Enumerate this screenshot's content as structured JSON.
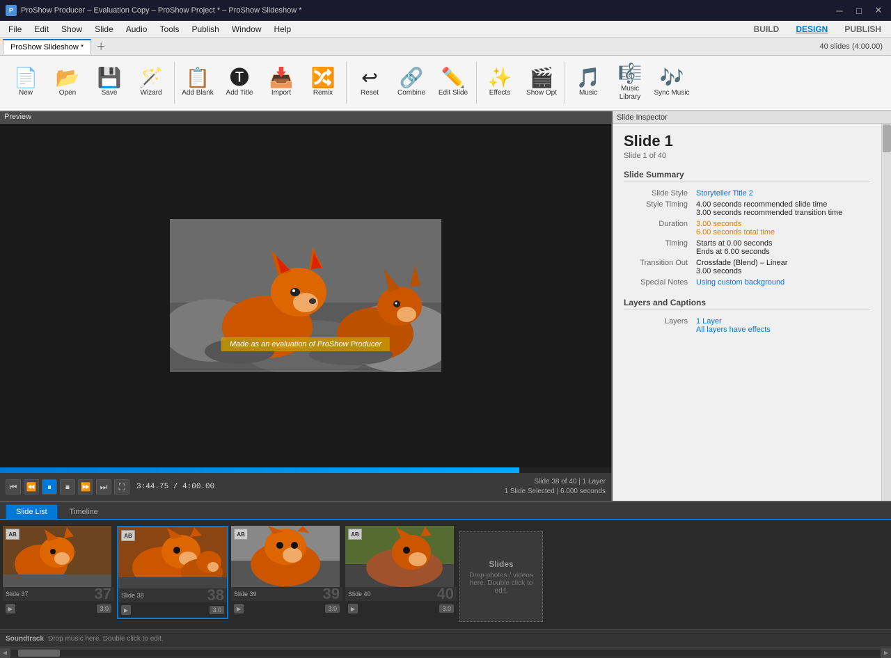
{
  "window": {
    "title": "ProShow Producer – Evaluation Copy – ProShow Project * – ProShow Slideshow *",
    "icon_label": "P"
  },
  "menubar": {
    "items": [
      "File",
      "Edit",
      "Show",
      "Slide",
      "Audio",
      "Tools",
      "Publish",
      "Window",
      "Help"
    ],
    "right": {
      "build": "BUILD",
      "design": "DESIGN",
      "publish": "PUBLISH"
    }
  },
  "tab": {
    "label": "ProShow Slideshow *",
    "slides_count": "40 slides (4:00.00)"
  },
  "toolbar": {
    "items": [
      {
        "id": "new",
        "icon": "📄",
        "label": "New"
      },
      {
        "id": "open",
        "icon": "📂",
        "label": "Open"
      },
      {
        "id": "save",
        "icon": "💾",
        "label": "Save"
      },
      {
        "id": "wizard",
        "icon": "🪄",
        "label": "Wizard"
      },
      {
        "id": "add_blank",
        "icon": "➕",
        "label": "Add Blank"
      },
      {
        "id": "add_title",
        "icon": "🅣",
        "label": "Add Title"
      },
      {
        "id": "import",
        "icon": "📥",
        "label": "Import"
      },
      {
        "id": "remix",
        "icon": "🔀",
        "label": "Remix"
      },
      {
        "id": "reset",
        "icon": "↩",
        "label": "Reset"
      },
      {
        "id": "combine",
        "icon": "🔗",
        "label": "Combine"
      },
      {
        "id": "edit_slide",
        "icon": "✏️",
        "label": "Edit Slide"
      },
      {
        "id": "effects",
        "icon": "✨",
        "label": "Effects"
      },
      {
        "id": "show_opt",
        "icon": "🎬",
        "label": "Show Opt"
      },
      {
        "id": "music",
        "icon": "🎵",
        "label": "Music"
      },
      {
        "id": "music_library",
        "icon": "🎼",
        "label": "Music Library"
      },
      {
        "id": "sync_music",
        "icon": "🎶",
        "label": "Sync Music"
      }
    ]
  },
  "preview": {
    "title": "Preview",
    "watermark": "Made as an evaluation of  ProShow Producer",
    "time_current": "3:44.75",
    "time_total": "4:00.00",
    "slide_info_line1": "Slide 38 of 40  |  1 Layer",
    "slide_info_line2": "1 Slide Selected  |  6.000 seconds",
    "progress_pct": 85
  },
  "inspector": {
    "title": "Slide Inspector",
    "slide_title": "Slide 1",
    "slide_subtitle": "Slide 1 of 40",
    "summary_title": "Slide Summary",
    "style_label": "Slide Style",
    "style_value": "Storyteller Title 2",
    "style_timing_label": "Style Timing",
    "style_timing_line1": "4.00 seconds recommended slide time",
    "style_timing_line2": "3.00 seconds recommended transition time",
    "duration_label": "Duration",
    "duration_value": "3.00 seconds",
    "duration_total": "6.00 seconds total time",
    "timing_label": "Timing",
    "timing_line1": "Starts at 0.00 seconds",
    "timing_line2": "Ends at 6.00 seconds",
    "transition_label": "Transition Out",
    "transition_value": "Crossfade (Blend) – Linear",
    "transition_time": "3.00 seconds",
    "notes_label": "Special Notes",
    "notes_value": "Using custom background",
    "layers_title": "Layers and Captions",
    "layers_label": "Layers",
    "layers_value": "1 Layer",
    "layers_note": "All layers have effects"
  },
  "bottom": {
    "tab_slidelist": "Slide List",
    "tab_timeline": "Timeline",
    "slides": [
      {
        "num": "37",
        "label": "Slide 37",
        "dur": "3.0"
      },
      {
        "num": "38",
        "label": "Slide 38",
        "dur": "3.0"
      },
      {
        "num": "39",
        "label": "Slide 39",
        "dur": "3.0"
      },
      {
        "num": "40",
        "label": "Slide 40",
        "dur": "3.0"
      }
    ],
    "drop_title": "Slides",
    "drop_hint": "Drop photos / videos here. Double click to edit.",
    "soundtrack_label": "Soundtrack",
    "soundtrack_hint": "Drop music here. Double click to edit."
  },
  "controls": {
    "rewind": "⏮",
    "back": "⏪",
    "pause": "⏸",
    "stop": "⏹",
    "forward": "⏩",
    "ffwd": "⏭",
    "fullscreen": "⛶"
  }
}
